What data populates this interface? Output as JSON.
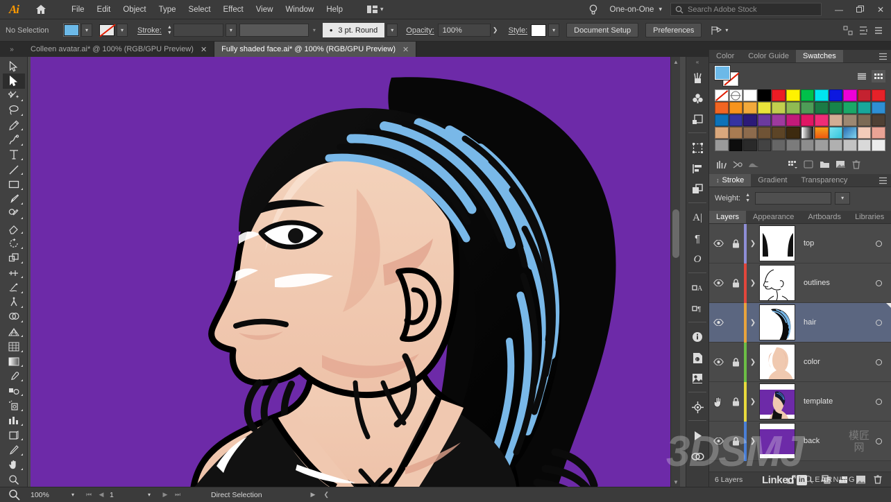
{
  "app": {
    "name": "Adobe Illustrator",
    "logo_text": "Ai"
  },
  "menubar": {
    "items": [
      "File",
      "Edit",
      "Object",
      "Type",
      "Select",
      "Effect",
      "View",
      "Window",
      "Help"
    ],
    "workspace": "One-on-One",
    "search_placeholder": "Search Adobe Stock",
    "window_buttons": {
      "minimize": "—",
      "restore": "❐",
      "close": "✕"
    }
  },
  "controlbar": {
    "selection_status": "No Selection",
    "fill_color": "#6cb9e8",
    "stroke_label": "Stroke:",
    "stroke_weight": "",
    "brush_definition": "3 pt. Round",
    "opacity_label": "Opacity:",
    "opacity_value": "100%",
    "style_label": "Style:",
    "document_setup": "Document Setup",
    "preferences": "Preferences"
  },
  "tabs": [
    {
      "title": "Colleen avatar.ai* @ 100% (RGB/GPU Preview)",
      "active": false,
      "close": "✕"
    },
    {
      "title": "Fully shaded face.ai* @ 100% (RGB/GPU Preview)",
      "active": true,
      "close": "✕"
    }
  ],
  "toolbar": {
    "tools": [
      {
        "name": "selection-tool",
        "selected": false
      },
      {
        "name": "direct-selection-tool",
        "selected": true
      },
      {
        "name": "magic-wand-tool",
        "selected": false
      },
      {
        "name": "lasso-tool",
        "selected": false
      },
      {
        "name": "pen-tool",
        "selected": false
      },
      {
        "name": "curvature-tool",
        "selected": false
      },
      {
        "name": "type-tool",
        "selected": false
      },
      {
        "name": "line-segment-tool",
        "selected": false
      },
      {
        "name": "rectangle-tool",
        "selected": false
      },
      {
        "name": "paintbrush-tool",
        "selected": false
      },
      {
        "name": "shaper-tool",
        "selected": false
      },
      {
        "name": "eraser-tool",
        "selected": false
      },
      {
        "name": "rotate-tool",
        "selected": false
      },
      {
        "name": "scale-tool",
        "selected": false
      },
      {
        "name": "width-tool",
        "selected": false
      },
      {
        "name": "free-transform-tool",
        "selected": false
      },
      {
        "name": "puppet-warp-tool",
        "selected": false
      },
      {
        "name": "shape-builder-tool",
        "selected": false
      },
      {
        "name": "perspective-grid-tool",
        "selected": false
      },
      {
        "name": "mesh-tool",
        "selected": false
      },
      {
        "name": "gradient-tool",
        "selected": false
      },
      {
        "name": "eyedropper-tool",
        "selected": false
      },
      {
        "name": "blend-tool",
        "selected": false
      },
      {
        "name": "symbol-sprayer-tool",
        "selected": false
      },
      {
        "name": "column-graph-tool",
        "selected": false
      },
      {
        "name": "artboard-tool",
        "selected": false
      },
      {
        "name": "slice-tool",
        "selected": false
      },
      {
        "name": "hand-tool",
        "selected": false
      },
      {
        "name": "zoom-tool",
        "selected": false
      }
    ]
  },
  "rail": {
    "icons": [
      "brushes-icon",
      "symbols-icon",
      "pathfinder-icon",
      "transform-icon",
      "align-icon",
      "pathfinder-panel-icon",
      "character-icon",
      "paragraph-icon",
      "glyphs-icon",
      "character-styles-icon",
      "paragraph-styles-icon",
      "swatches-rail-icon",
      "document-info-icon",
      "asset-export-icon",
      "links-icon",
      "navigator-icon",
      "actions-icon",
      "links-chain-icon"
    ]
  },
  "panels": {
    "color_group": {
      "tabs": [
        "Color",
        "Color Guide",
        "Swatches"
      ],
      "active": "Swatches"
    },
    "swatches": {
      "row1": [
        "none",
        "registration",
        "#ffffff",
        "#000000",
        "#ed1c24",
        "#fff200",
        "#00a651",
        "#00aeef",
        "#2e3192",
        "#ec008c",
        "#c1272d",
        "#ed1c24"
      ],
      "row2": [
        "#f26522",
        "#f7941d",
        "#fbb040",
        "#f9ed32",
        "#cadb2a",
        "#8dc63f",
        "#39b54a",
        "#00874a",
        "#00a064",
        "#00a99d",
        "#2bb673",
        "#0e9ed6"
      ],
      "row3": [
        "#0073ae",
        "#2e3192",
        "#1b1464",
        "#662d91",
        "#92278f",
        "#c1198c",
        "#ed1164",
        "#ee2a7b",
        "#d3b196",
        "#a08a72",
        "#7b6a55",
        "#4c3f32"
      ],
      "row4": [
        "#d9a679",
        "#a9784f",
        "#8a6a4d",
        "#6e5233",
        "#7a5a20",
        "#4a3012",
        "gradient-white-black",
        "gradient-orange",
        "pattern-aqua",
        "pattern-blue",
        "#f0c7b6",
        "#e4a090"
      ],
      "row5": [
        "folder",
        "#111111",
        "#2b2b2b",
        "#3f3f3f",
        "#6a6a6a",
        "#8a8a8a",
        "#9a9a9a",
        "#a8a8a8",
        "#b5b5b5",
        "#c4c4c4",
        "#d6d6d6",
        "#e8e8e8"
      ]
    },
    "stroke_group": {
      "tabs": [
        "Stroke",
        "Gradient",
        "Transparency"
      ],
      "active": "Stroke",
      "weight_label": "Weight:",
      "weight_value": ""
    },
    "layers_group": {
      "tabs": [
        "Layers",
        "Appearance",
        "Artboards",
        "Libraries"
      ],
      "active": "Layers",
      "footer_count": "6 Layers",
      "rows": [
        {
          "name": "top",
          "color": "#8e8ed6",
          "visible": true,
          "locked": true,
          "selected": false,
          "eye_icon": "eye-icon",
          "lock_icon": "lock-icon"
        },
        {
          "name": "outlines",
          "color": "#e2463c",
          "visible": true,
          "locked": true,
          "selected": false,
          "eye_icon": "eye-icon",
          "lock_icon": "lock-icon"
        },
        {
          "name": "hair",
          "color": "#e8a33d",
          "visible": true,
          "locked": false,
          "selected": true,
          "eye_icon": "eye-icon",
          "lock_icon": ""
        },
        {
          "name": "color",
          "color": "#6cbe45",
          "visible": true,
          "locked": true,
          "selected": false,
          "eye_icon": "eye-icon",
          "lock_icon": "lock-icon"
        },
        {
          "name": "template",
          "color": "#e8d93d",
          "visible": false,
          "locked": true,
          "selected": false,
          "eye_icon": "hand-cursor-icon",
          "lock_icon": "lock-icon"
        },
        {
          "name": "back",
          "color": "#4a7fd6",
          "visible": true,
          "locked": true,
          "selected": false,
          "eye_icon": "eye-icon",
          "lock_icon": "lock-icon"
        }
      ]
    }
  },
  "statusbar": {
    "zoom_level": "100%",
    "page_number": "1",
    "current_tool": "Direct Selection"
  },
  "artwork": {
    "background_color": "#6d2aa8",
    "skin_base": "#f0c9b0",
    "skin_shadow": "#e0a896",
    "skin_light": "#f7ddcb",
    "hair_black": "#0a0a0a",
    "hair_blue": "#79b8e8",
    "top_black": "#111111",
    "outline": "#000000"
  },
  "watermarks": {
    "brand": "3DSMJ",
    "cjk": "模匠网",
    "linkedin_text": "Linked",
    "linkedin_badge": "in",
    "learning": "LEARNING"
  }
}
